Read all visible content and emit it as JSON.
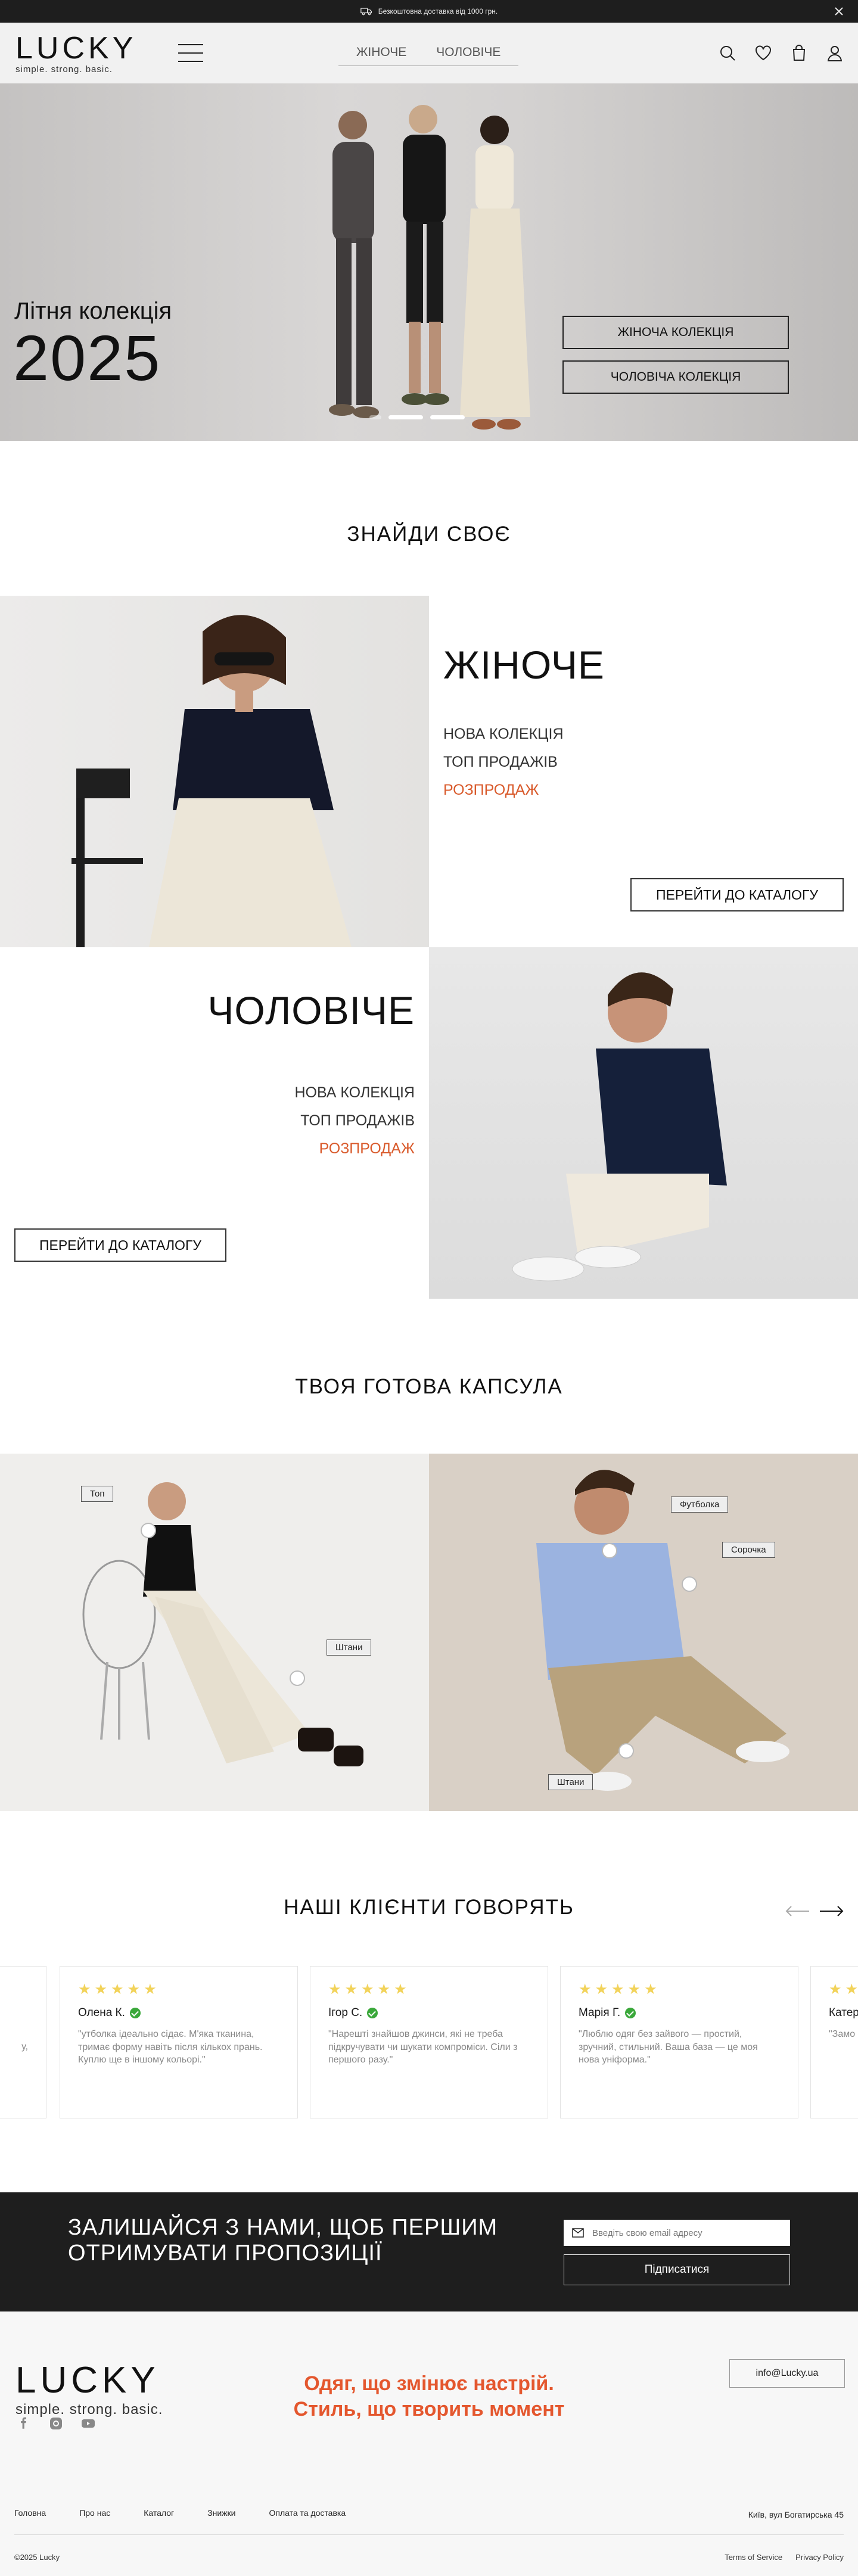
{
  "topbar": {
    "shipping_text": "Безкоштовна доставка від 1000 грн."
  },
  "brand": {
    "name": "LUCKY",
    "tagline": "simple. strong. basic."
  },
  "header": {
    "nav": [
      "ЖІНОЧЕ",
      "ЧОЛОВІЧЕ"
    ],
    "icons": [
      "search-icon",
      "heart-icon",
      "bag-icon",
      "user-icon"
    ]
  },
  "hero": {
    "title": "Літня колекція",
    "year": "2025",
    "buttons": [
      "ЖІНОЧА КОЛЕКЦІЯ",
      "ЧОЛОВІЧА КОЛЕКЦІЯ"
    ],
    "slides": 3,
    "active_slide": 2
  },
  "find_section": {
    "title": "ЗНАЙДИ СВОЄ"
  },
  "women": {
    "title": "ЖІНОЧЕ",
    "links": [
      "НОВА КОЛЕКЦІЯ",
      "ТОП ПРОДАЖІВ",
      "РОЗПРОДАЖ"
    ],
    "button": "ПЕРЕЙТИ ДО КАТАЛОГУ"
  },
  "men": {
    "title": "ЧОЛОВІЧЕ",
    "links": [
      "НОВА КОЛЕКЦІЯ",
      "ТОП ПРОДАЖІВ",
      "РОЗПРОДАЖ"
    ],
    "button": "ПЕРЕЙТИ ДО КАТАЛОГУ"
  },
  "capsule": {
    "title": "ТВОЯ ГОТОВА КАПСУЛА",
    "women_tags": [
      "Топ",
      "Штани"
    ],
    "men_tags": [
      "Футболка",
      "Сорочка",
      "Штани"
    ]
  },
  "reviews": {
    "title": "НАШІ КЛІЄНТИ ГОВОРЯТЬ",
    "items": [
      {
        "name": "Олена К.",
        "text": "\"утболка ідеально сідає. М'яка тканина, тримає форму навіть після кількох прань. Куплю ще в іншому кольорі.\"",
        "stars": 5
      },
      {
        "name": "Ігор С.",
        "text": "\"Нарешті знайшов джинси, які не треба підкручувати чи шукати компроміси. Сіли з першого разу.\"",
        "stars": 5
      },
      {
        "name": "Марія Г.",
        "text": "\"Люблю одяг без зайвого — простий, зручний, стильний. Ваша база — це моя нова уніформа.\"",
        "stars": 5
      },
      {
        "name": "Катер",
        "text": "\"Замо нескі речі, і",
        "stars": 5
      }
    ],
    "left_partial_text": "у,"
  },
  "subscribe": {
    "headline": "ЗАЛИШАЙСЯ З НАМИ, ЩОБ ПЕРШИМ ОТРИМУВАТИ ПРОПОЗИЦІЇ",
    "email_placeholder": "Введіть свою email адресу",
    "button": "Підписатися"
  },
  "footer": {
    "slogan_line1": "Одяг, що змінює настрій.",
    "slogan_line2": "Стиль, що творить момент",
    "email": "info@Lucky.ua",
    "links": [
      "Головна",
      "Про нас",
      "Каталог",
      "Знижки",
      "Оплата та доставка"
    ],
    "address": "Київ, вул Богатирська 45",
    "copyright": "©2025 Lucky",
    "legal": [
      "Terms of Service",
      "Privacy Policy"
    ],
    "social": [
      "facebook-icon",
      "instagram-icon",
      "youtube-icon"
    ]
  },
  "colors": {
    "accent": "#e4572e",
    "sale": "#d95a2b",
    "dark": "#1e1e1e",
    "star": "#f2d35a",
    "verified": "#3aa83a"
  }
}
